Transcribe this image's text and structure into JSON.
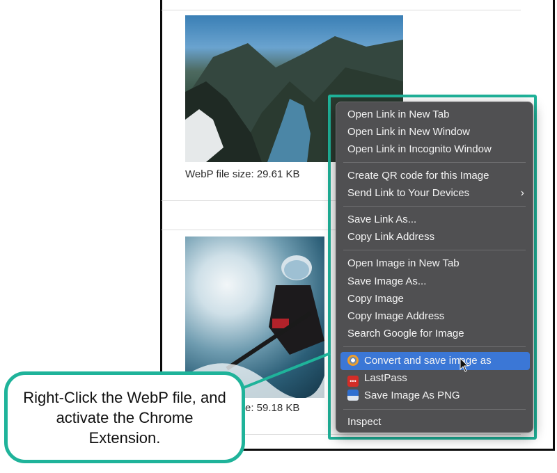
{
  "page": {
    "caption_1": "WebP file size: 29.61 KB",
    "caption_2_visible": "e: 59.18 KB"
  },
  "context_menu": {
    "groups": [
      [
        "Open Link in New Tab",
        "Open Link in New Window",
        "Open Link in Incognito Window"
      ],
      [
        "Create QR code for this Image",
        "Send Link to Your Devices"
      ],
      [
        "Save Link As...",
        "Copy Link Address"
      ],
      [
        "Open Image in New Tab",
        "Save Image As...",
        "Copy Image",
        "Copy Image Address",
        "Search Google for Image"
      ],
      [
        "Convert and save image as",
        "LastPass",
        "Save Image As PNG"
      ],
      [
        "Inspect"
      ]
    ],
    "items": {
      "open_link_new_tab": "Open Link in New Tab",
      "open_link_new_window": "Open Link in New Window",
      "open_link_incognito": "Open Link in Incognito Window",
      "create_qr": "Create QR code for this Image",
      "send_link": "Send Link to Your Devices",
      "save_link_as": "Save Link As...",
      "copy_link_address": "Copy Link Address",
      "open_image_new_tab": "Open Image in New Tab",
      "save_image_as": "Save Image As...",
      "copy_image": "Copy Image",
      "copy_image_address": "Copy Image Address",
      "search_google_image": "Search Google for Image",
      "convert_and_save": "Convert and save image as",
      "lastpass": "LastPass",
      "save_image_as_png": "Save Image As PNG",
      "inspect": "Inspect"
    },
    "active_item": "Convert and save image as"
  },
  "callout": {
    "text": "Right-Click the WebP file, and activate the Chrome Extension."
  },
  "colors": {
    "accent_teal": "#1fb39a",
    "menu_bg": "#505052",
    "menu_highlight": "#3b77d6"
  }
}
